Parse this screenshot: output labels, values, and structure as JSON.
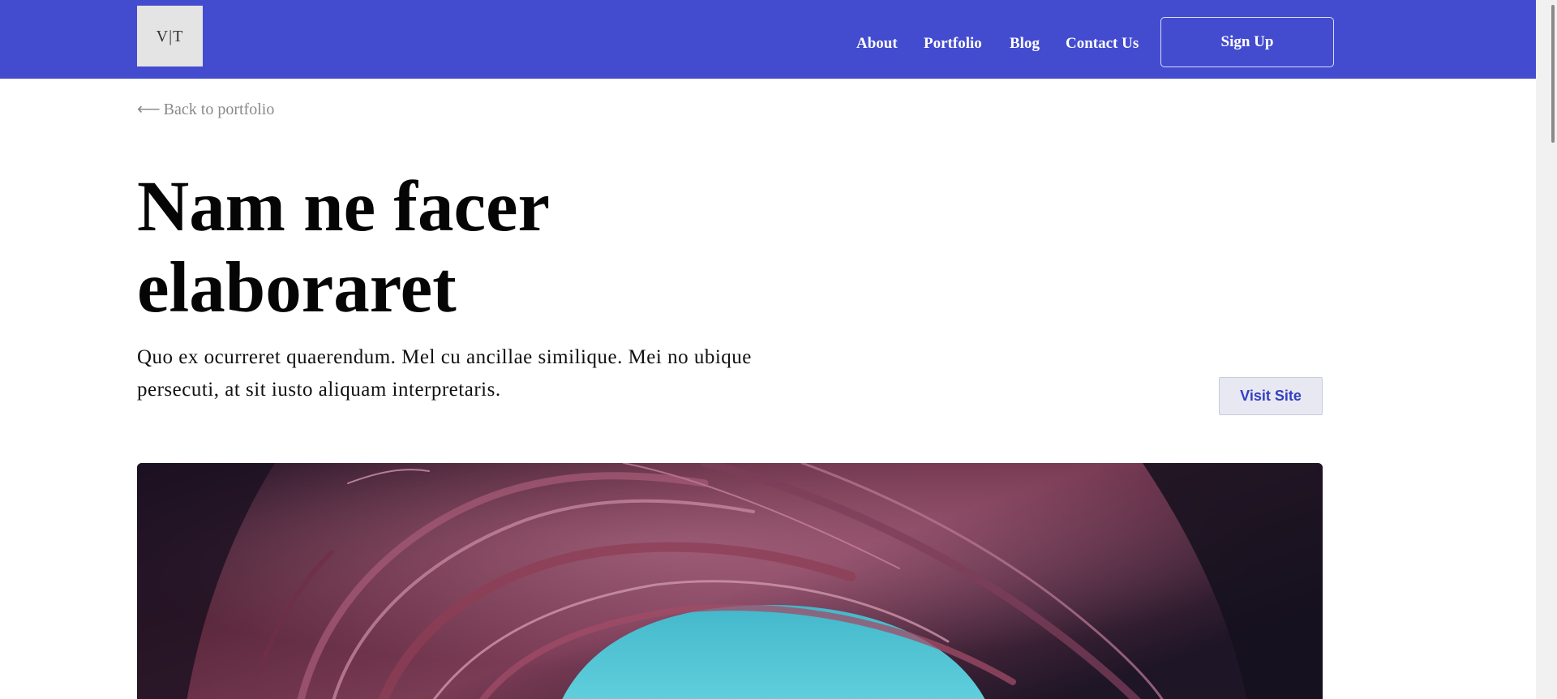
{
  "header": {
    "logo_text": "V|T",
    "nav": [
      {
        "label": "About"
      },
      {
        "label": "Portfolio"
      },
      {
        "label": "Blog"
      },
      {
        "label": "Contact Us"
      }
    ],
    "signup_label": "Sign Up",
    "bg_color": "#434ccf"
  },
  "main": {
    "back_label": "Back to portfolio",
    "back_arrow": "⟵",
    "title": "Nam ne facer elaboraret",
    "description": "Quo ex ocurreret quaerendum. Mel cu ancillae similique. Mei no ubique persecuti, at sit iusto aliquam interpretaris.",
    "visit_label": "Visit Site"
  },
  "hero_image": {
    "subject": "canyon-arch-photo",
    "colors": {
      "sky": "#4fc3d3",
      "rock_dark": "#1a1020",
      "rock_mid": "#6b2e45",
      "rock_light": "#b8798e"
    }
  }
}
